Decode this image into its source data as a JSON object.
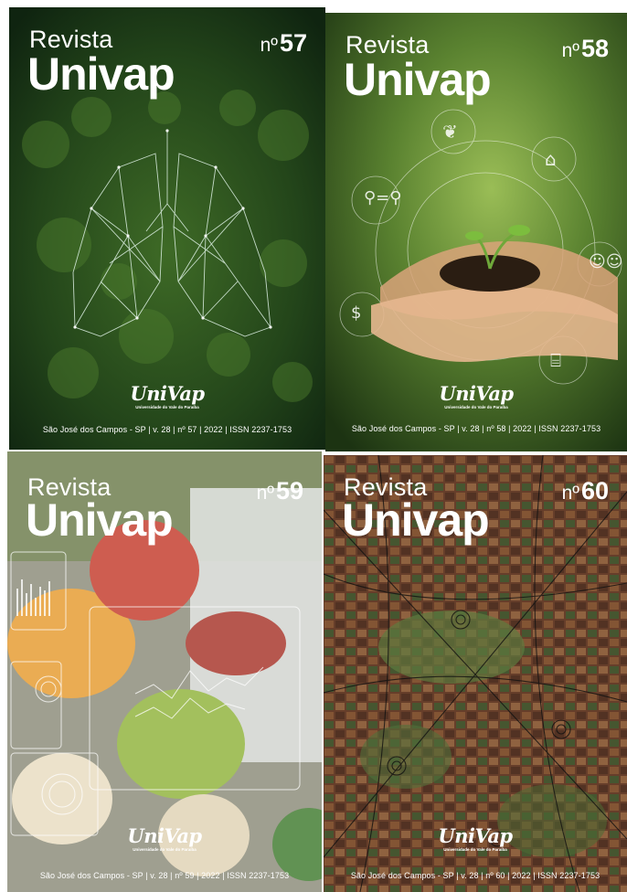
{
  "covers": [
    {
      "revista": "Revista",
      "univap": "Univap",
      "num_prefix": "nº",
      "number": "57",
      "logo": "UniVap",
      "logo_sub": "Universidade do Vale do Paraíba",
      "footer": "São José dos Campos - SP | v. 28 | nº 57 | 2022 | ISSN 2237-1753",
      "palette": {
        "dark": "#163512",
        "mid": "#2f5a1f",
        "light": "#5c8a36"
      },
      "artwork": "lungs-wireframe-over-forest"
    },
    {
      "revista": "Revista",
      "univap": "Univap",
      "num_prefix": "nº",
      "number": "58",
      "logo": "UniVap",
      "logo_sub": "Universidade do Vale do Paraíba",
      "footer": "São José dos Campos - SP | v. 28 | nº 58 | 2022 | ISSN 2237-1753",
      "palette": {
        "dark": "#1f3612",
        "mid": "#3f6321",
        "light": "#8fb44a"
      },
      "artwork": "hands-holding-seedling-with-sustainability-icons"
    },
    {
      "revista": "Revista",
      "univap": "Univap",
      "num_prefix": "nº",
      "number": "59",
      "logo": "UniVap",
      "logo_sub": "Universidade do Vale do Paraíba",
      "footer": "São José dos Campos - SP | v. 28 | nº 59 | 2022 | ISSN 2237-1753",
      "palette": {
        "dark": "#4a4a3a",
        "mid": "#c8893a",
        "light": "#e8e4d8"
      },
      "artwork": "vegetables-with-data-overlay"
    },
    {
      "revista": "Revista",
      "univap": "Univap",
      "num_prefix": "nº",
      "number": "60",
      "logo": "UniVap",
      "logo_sub": "Universidade do Vale do Paraíba",
      "footer": "São José dos Campos - SP | v. 28 | nº 60 | 2022 | ISSN 2237-1753",
      "palette": {
        "dark": "#5a3322",
        "mid": "#8a5a3a",
        "light": "#4f6a3a"
      },
      "artwork": "aerial-city-map-with-network"
    }
  ]
}
